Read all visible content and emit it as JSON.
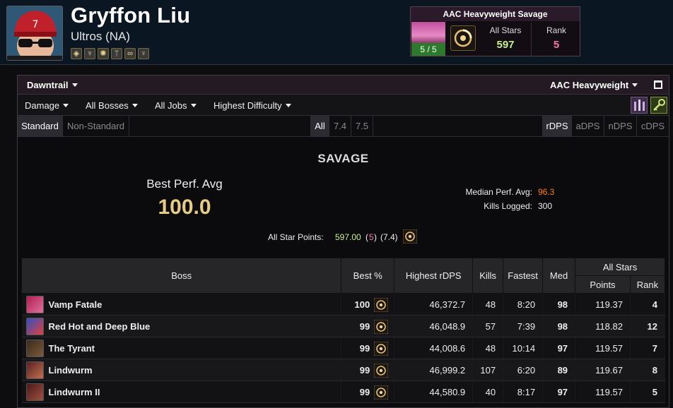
{
  "character": {
    "name": "Gryffon Liu",
    "server": "Ultros (NA)",
    "job_icons": [
      "tank-job-icon",
      "healer-job-icon",
      "star-job-icon",
      "wings-job-icon",
      "infinity-job-icon",
      "key-job-icon"
    ],
    "job_glyphs": [
      "◈",
      "♆",
      "✺",
      "ᛘ",
      "∞",
      "♀"
    ]
  },
  "zone_card": {
    "title": "AAC Heavyweight Savage",
    "kills": "5 / 5",
    "all_stars_label": "All Stars",
    "all_stars_value": "597",
    "rank_label": "Rank",
    "rank_value": "5"
  },
  "filters": {
    "expansion": "Dawntrail",
    "zone": "AAC Heavyweight",
    "metric": "Damage",
    "bosses": "All Bosses",
    "jobs": "All Jobs",
    "difficulty": "Highest Difficulty",
    "standard": "Standard",
    "non_standard": "Non-Standard",
    "patches": [
      "All",
      "7.4",
      "7.5"
    ],
    "dps_types": [
      "rDPS",
      "aDPS",
      "nDPS",
      "cDPS"
    ]
  },
  "summary": {
    "title": "SAVAGE",
    "best_perf_label": "Best Perf. Avg",
    "best_perf_value": "100.0",
    "median_label": "Median Perf. Avg:",
    "median_value": "96.3",
    "kills_label": "Kills Logged:",
    "kills_value": "300",
    "asp_label": "All Star Points:",
    "asp_points": "597.00",
    "asp_rank_open": "(",
    "asp_rank": "5",
    "asp_rank_close": ")",
    "asp_patch": "(7.4)"
  },
  "table": {
    "headers": {
      "boss": "Boss",
      "best": "Best %",
      "rdps": "Highest rDPS",
      "kills": "Kills",
      "fastest": "Fastest",
      "med": "Med",
      "all_stars": "All Stars",
      "points": "Points",
      "rank": "Rank"
    },
    "rows": [
      {
        "boss": "Vamp Fatale",
        "best": "100",
        "rdps": "46,372.7",
        "kills": "48",
        "fastest": "8:20",
        "med": "98",
        "points": "119.37",
        "rank": "4"
      },
      {
        "boss": "Red Hot and Deep Blue",
        "best": "99",
        "rdps": "46,048.9",
        "kills": "57",
        "fastest": "7:39",
        "med": "98",
        "points": "118.82",
        "rank": "12"
      },
      {
        "boss": "The Tyrant",
        "best": "99",
        "rdps": "44,008.6",
        "kills": "48",
        "fastest": "10:14",
        "med": "97",
        "points": "119.57",
        "rank": "7"
      },
      {
        "boss": "Lindwurm",
        "best": "99",
        "rdps": "46,999.2",
        "kills": "107",
        "fastest": "6:20",
        "med": "89",
        "points": "119.67",
        "rank": "8"
      },
      {
        "boss": "Lindwurm II",
        "best": "99",
        "rdps": "44,580.9",
        "kills": "40",
        "fastest": "8:17",
        "med": "97",
        "points": "119.57",
        "rank": "5"
      }
    ]
  },
  "colors": {
    "legendary": "#e5cc80",
    "pink": "#e268a8",
    "orange": "#ff8000",
    "purple": "#a335ee",
    "points_green": "#c8f08a",
    "rank_pink": "#ff72a8"
  }
}
